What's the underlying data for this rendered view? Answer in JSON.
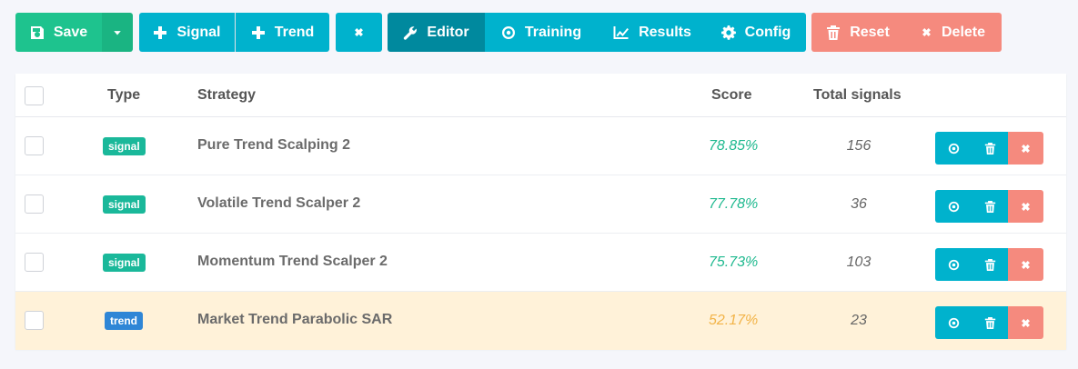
{
  "toolbar": {
    "save_label": "Save",
    "signal_label": "Signal",
    "trend_label": "Trend",
    "editor_label": "Editor",
    "training_label": "Training",
    "results_label": "Results",
    "config_label": "Config",
    "reset_label": "Reset",
    "delete_label": "Delete"
  },
  "table": {
    "columns": {
      "type": "Type",
      "strategy": "Strategy",
      "score": "Score",
      "total_signals": "Total signals"
    },
    "rows": [
      {
        "type": "signal",
        "strategy": "Pure Trend Scalping 2",
        "score": "78.85%",
        "total_signals": "156",
        "highlighted": false
      },
      {
        "type": "signal",
        "strategy": "Volatile Trend Scalper 2",
        "score": "77.78%",
        "total_signals": "36",
        "highlighted": false
      },
      {
        "type": "signal",
        "strategy": "Momentum Trend Scalper 2",
        "score": "75.73%",
        "total_signals": "103",
        "highlighted": false
      },
      {
        "type": "trend",
        "strategy": "Market Trend Parabolic SAR",
        "score": "52.17%",
        "total_signals": "23",
        "highlighted": true
      }
    ]
  },
  "colors": {
    "save": "#1ec38e",
    "primary": "#00b2cd",
    "primary_active": "#00899e",
    "danger": "#f58a7e",
    "score_good": "#1fb98f",
    "score_warn": "#f2b347",
    "badge_signal": "#1ab89a",
    "badge_trend": "#2f86d6",
    "highlight_row": "#fff2d9"
  },
  "icons": {
    "save": "floppy-disk-icon",
    "dropdown": "caret-down-icon",
    "add": "plus-icon",
    "close": "times-icon",
    "editor": "wrench-icon",
    "training": "dot-circle-icon",
    "results": "line-chart-icon",
    "config": "gear-icon",
    "reset": "trash-icon",
    "delete": "times-icon",
    "row_view": "dot-circle-icon",
    "row_trash": "trash-icon",
    "row_remove": "times-icon"
  }
}
